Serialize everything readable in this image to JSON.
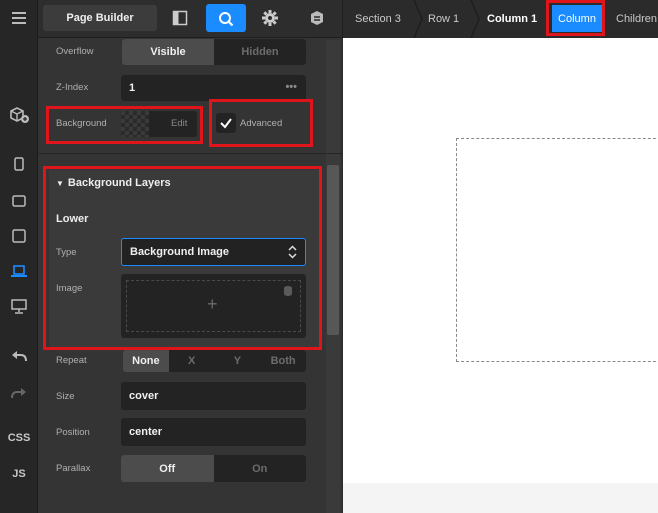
{
  "rail": {
    "menu_icon": "hamburger-icon",
    "items": [
      {
        "name": "add-element-icon"
      },
      {
        "name": "phone-icon"
      },
      {
        "name": "tablet-landscape-icon"
      },
      {
        "name": "tablet-icon"
      },
      {
        "name": "laptop-icon"
      },
      {
        "name": "desktop-icon"
      },
      {
        "name": "undo-icon"
      },
      {
        "name": "redo-icon"
      }
    ],
    "css_label": "CSS",
    "js_label": "JS"
  },
  "toolbar": {
    "title": "Page Builder",
    "layout_icon": "layout-icon",
    "search_icon": "search-icon",
    "settings_icon": "gear-icon",
    "shield_icon": "shield-icon"
  },
  "breadcrumb": [
    "Section 3",
    "Row 1",
    "Column 1",
    "Column",
    "Children"
  ],
  "inspector": {
    "overflow": {
      "label": "Overflow",
      "options": [
        "Visible",
        "Hidden"
      ],
      "selected": "Visible"
    },
    "zindex": {
      "label": "Z-Index",
      "value": "1"
    },
    "background": {
      "label": "Background",
      "edit_label": "Edit"
    },
    "advanced": {
      "label": "Advanced",
      "checked": true
    },
    "layers": {
      "title": "Background Layers",
      "layer_name": "Lower",
      "type": {
        "label": "Type",
        "value": "Background Image"
      },
      "image": {
        "label": "Image",
        "add_symbol": "+"
      }
    },
    "repeat": {
      "label": "Repeat",
      "options": [
        "None",
        "X",
        "Y",
        "Both"
      ],
      "selected": "None"
    },
    "size": {
      "label": "Size",
      "value": "cover"
    },
    "position": {
      "label": "Position",
      "value": "center"
    },
    "parallax": {
      "label": "Parallax",
      "options": [
        "Off",
        "On"
      ],
      "selected": "Off"
    }
  },
  "colors": {
    "accent": "#1a8cff",
    "highlight": "#e0141b",
    "panel": "#343434"
  }
}
